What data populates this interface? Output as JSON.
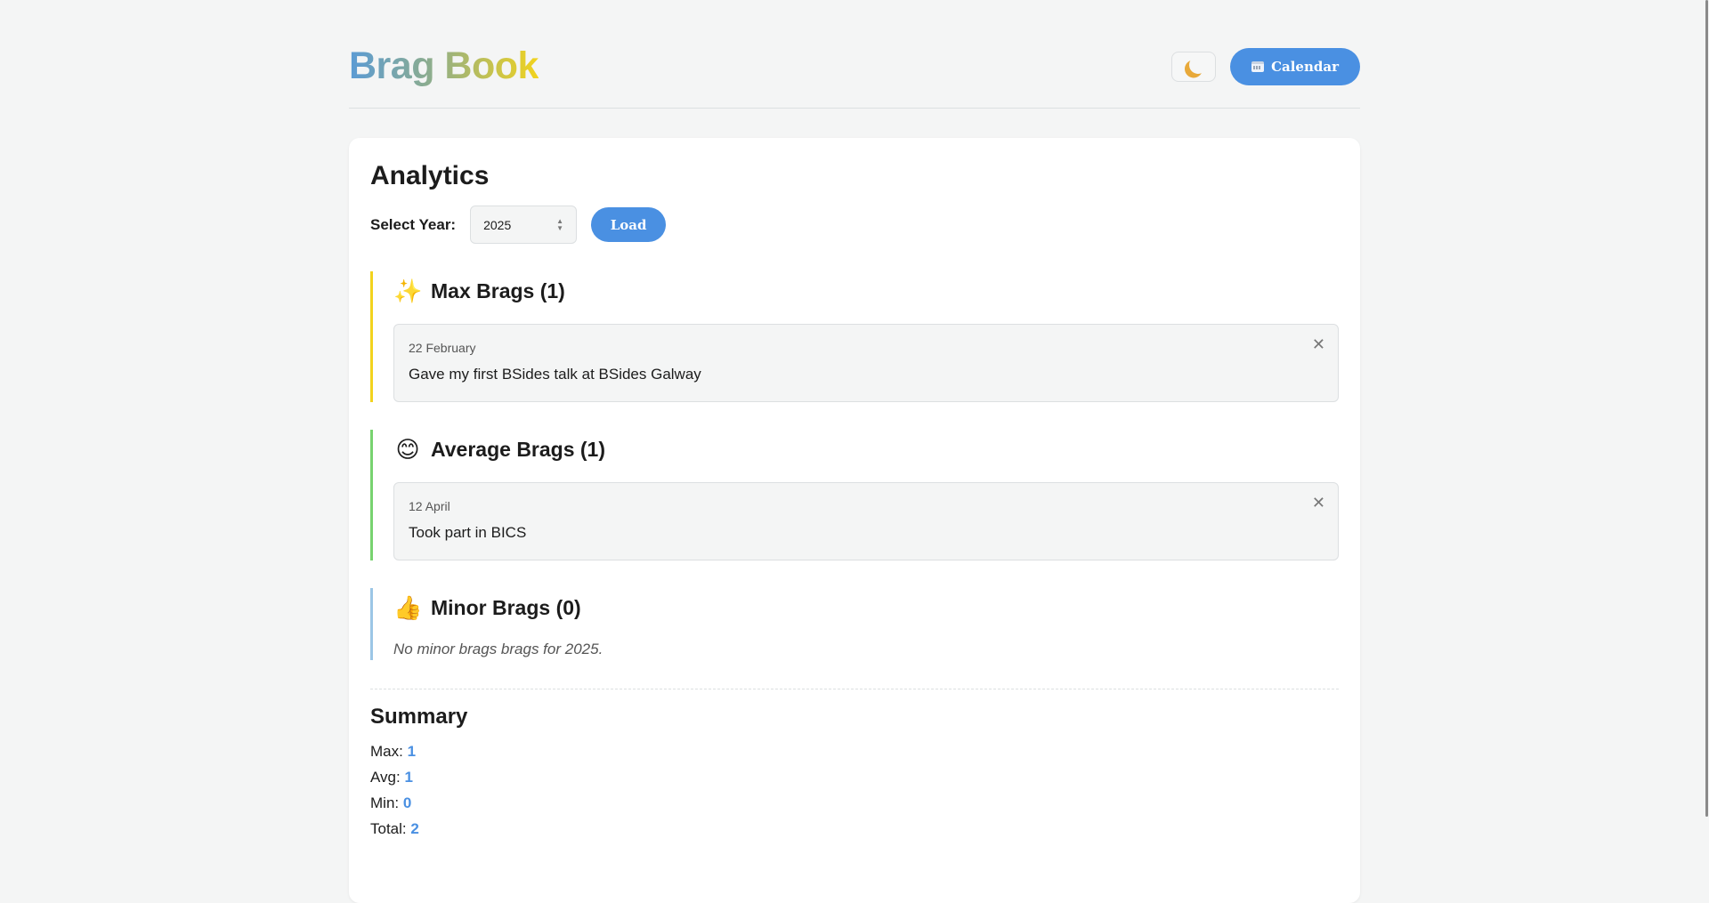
{
  "app": {
    "logo_word1": "Brag",
    "logo_word2": "Book"
  },
  "header": {
    "theme_icon": "moon-icon",
    "calendar_icon": "calendar-icon",
    "calendar_label": "Calendar"
  },
  "analytics": {
    "title": "Analytics",
    "year_label": "Select Year:",
    "year_value": "2025",
    "load_label": "Load"
  },
  "sections": [
    {
      "title": "Max Brags (1)",
      "emoji": "✨",
      "accent": "#f2d31e",
      "entries": [
        {
          "date": "22 February",
          "text": "Gave my first BSides talk at BSides Galway"
        }
      ]
    },
    {
      "title": "Average Brags (1)",
      "emoji": "😊",
      "accent": "#78d36f",
      "entries": [
        {
          "date": "12 April",
          "text": "Took part in BICS"
        }
      ]
    },
    {
      "title": "Minor Brags (0)",
      "emoji": "👍",
      "accent": "#9cc6e6",
      "empty_text": "No minor brags brags for 2025."
    }
  ],
  "summary": {
    "title": "Summary",
    "max_label": "Max:",
    "max_value": "1",
    "avg_label": "Avg:",
    "avg_value": "1",
    "min_label": "Min:",
    "min_value": "0",
    "total_label": "Total:",
    "total_value": "2"
  },
  "close_glyph": "✕"
}
